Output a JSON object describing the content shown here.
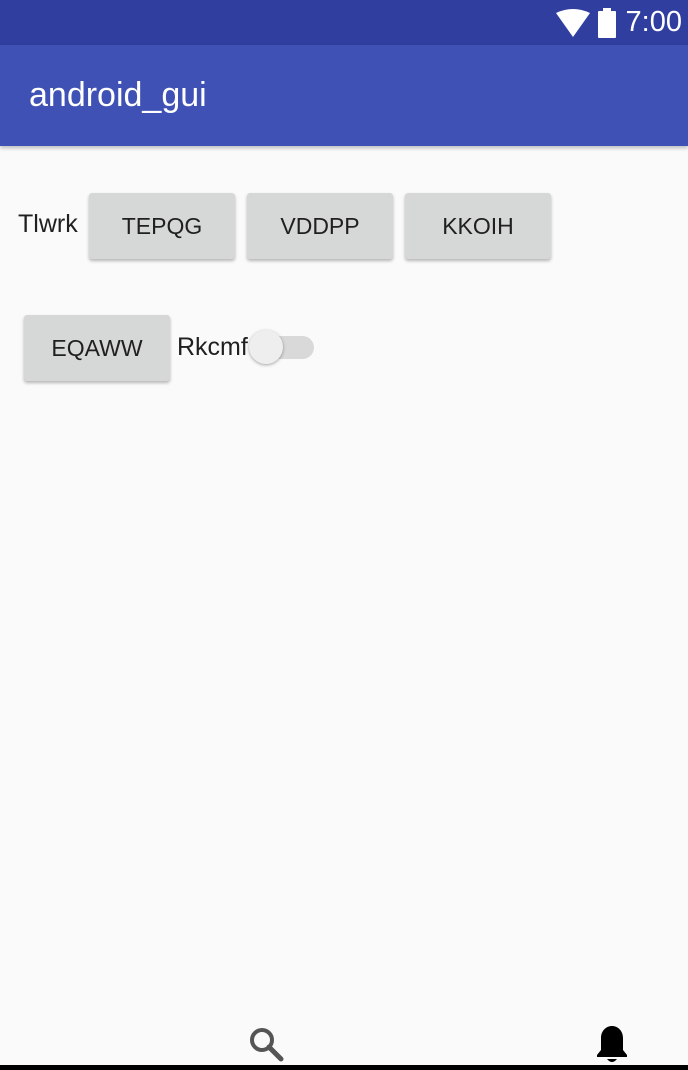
{
  "status_bar": {
    "time": "7:00",
    "background_color": "#303f9f",
    "icons": [
      "wifi-icon",
      "battery-icon"
    ]
  },
  "app_bar": {
    "title": "android_gui",
    "background_color": "#3f51b5"
  },
  "row1": {
    "label": "Tlwrk",
    "buttons": [
      "TEPQG",
      "VDDPP",
      "KKOIH"
    ]
  },
  "row2": {
    "button": "EQAWW",
    "switch": {
      "label": "Rkcmf",
      "checked": false
    }
  },
  "bottom_nav": {
    "icons": [
      "search-icon",
      "bell-icon"
    ]
  }
}
